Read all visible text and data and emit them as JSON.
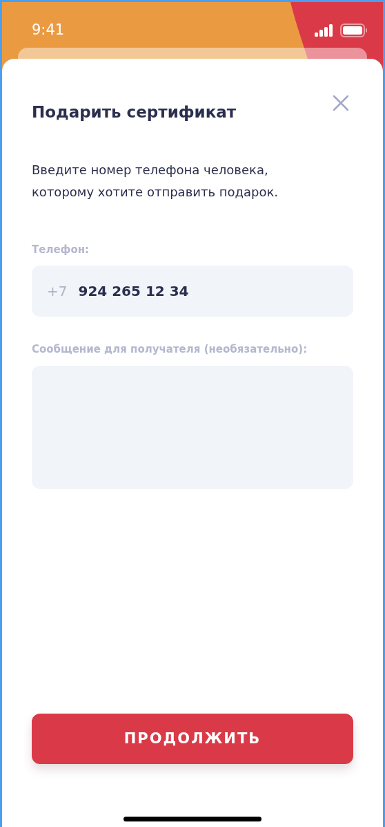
{
  "status_bar": {
    "time": "9:41"
  },
  "sheet": {
    "title": "Подарить сертификат",
    "description": "Введите номер телефона человека, которому хотите отправить подарок.",
    "phone_field": {
      "label": "Телефон:",
      "prefix": "+7",
      "value": "924 265 12 34"
    },
    "message_field": {
      "label": "Сообщение для получателя (необязательно):"
    },
    "button": "ПРОДОЛЖИТЬ"
  }
}
